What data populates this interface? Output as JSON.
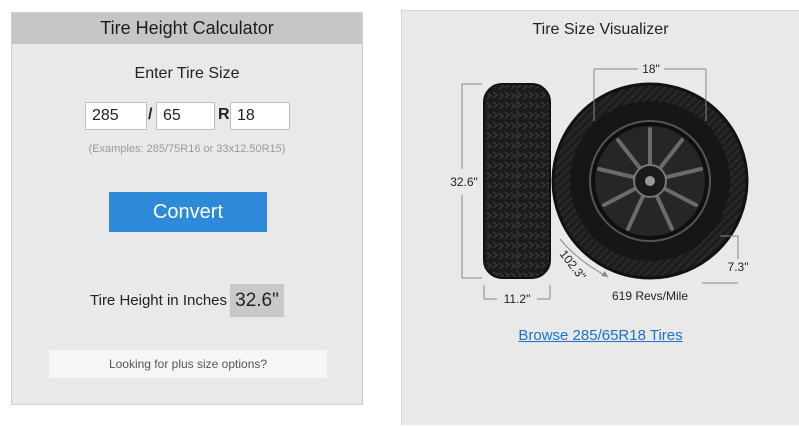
{
  "calculator": {
    "title": "Tire Height Calculator",
    "enter_label": "Enter Tire Size",
    "width_value": "285",
    "separator_slash": "/",
    "aspect_value": "65",
    "separator_r": "R",
    "rim_value": "18",
    "examples": "(Examples: 285/75R16 or 33x12.50R15)",
    "convert_label": "Convert",
    "result_label": "Tire Height in Inches",
    "result_value": "32.6\"",
    "plus_size_label": "Looking for plus size options?"
  },
  "visualizer": {
    "title": "Tire Size Visualizer",
    "rim_dim": "18\"",
    "height_dim": "32.6\"",
    "width_dim": "11.2\"",
    "circumference_dim": "102.3\"",
    "sidewall_dim": "7.3\"",
    "revs": "619 Revs/Mile",
    "browse_link": "Browse 285/65R18 Tires"
  },
  "colors": {
    "accent": "#2d8ad8",
    "link": "#1a73c6",
    "panel_bg": "#e9e9e9",
    "header_bg": "#c6c6c6",
    "tire": "#1b1b1b"
  }
}
